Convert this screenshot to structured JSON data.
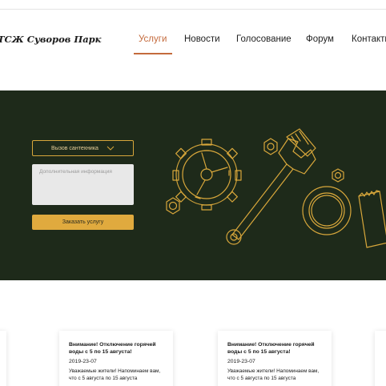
{
  "header": {
    "brand": "ТСЖ Суворов Парк",
    "nav": [
      {
        "label": "Услуги",
        "active": true
      },
      {
        "label": "Новости",
        "active": false
      },
      {
        "label": "Голосование",
        "active": false
      },
      {
        "label": "Форум",
        "active": false
      },
      {
        "label": "Контакты",
        "active": false
      }
    ]
  },
  "hero": {
    "service_select": "Вызов сантехника",
    "info_placeholder": "Дополнительная информация",
    "order_button": "Заказать услугу"
  },
  "news": [
    {
      "title": "Внимание! Отключение горячей воды с 5 по 15 августа!",
      "date": "2019-23-07",
      "text": "Уважаемые жители! Напоминаем вам, что с 5 августа по 15 августа"
    },
    {
      "title": "Внимание! Отключение горячей воды с 5 по 15 августа!",
      "date": "2019-23-07",
      "text": "Уважаемые жители! Напоминаем вам, что с 5 августа по 15 августа"
    }
  ],
  "colors": {
    "accent": "#c46a3c",
    "hero_bg": "#1e2a1a",
    "gold": "#e0aa3e"
  }
}
